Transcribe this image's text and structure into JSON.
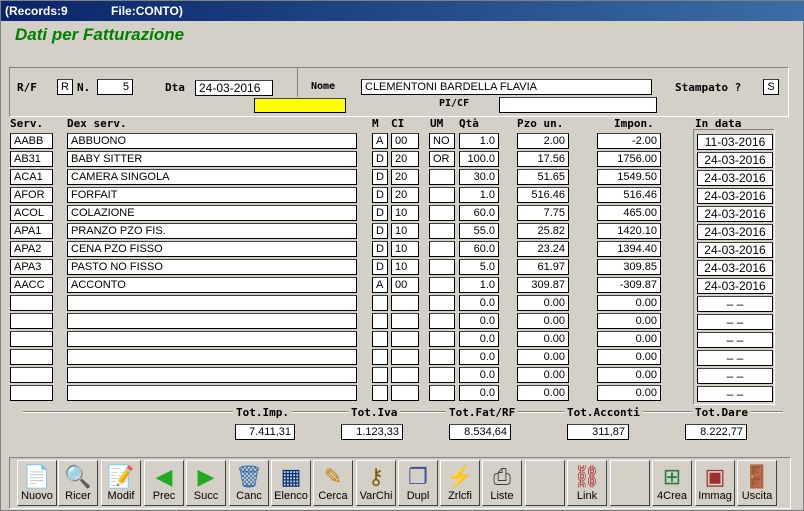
{
  "titlebar": {
    "records": "(Records:9",
    "file": "File:CONTO)"
  },
  "heading": "Dati per Fatturazione",
  "header": {
    "rf_label": "R/F",
    "rf_value": "R",
    "n_label": "N.",
    "n_value": "5",
    "dta_label": "Dta",
    "dta_value": "24-03-2016",
    "nome_label": "Nome",
    "nome_value": "CLEMENTONI BARDELLA FLAVIA",
    "stampato_label": "Stampato ?",
    "stampato_value": "S",
    "picf_label": "PI/CF",
    "picf_value": ""
  },
  "columns": {
    "serv": "Serv.",
    "dex": "Dex serv.",
    "m": "M",
    "ci": "CI",
    "um": "UM",
    "qta": "Qtà",
    "pzo": "Pzo un.",
    "impon": "Impon.",
    "indata": "In data"
  },
  "rows": [
    {
      "serv": "AABB",
      "dex": "ABBUONO",
      "m": "A",
      "ci": "00",
      "um": "NO",
      "qta": "1.0",
      "pzo": "2.00",
      "impon": "-2.00",
      "indata": "11-03-2016"
    },
    {
      "serv": "AB31",
      "dex": "BABY SITTER",
      "m": "D",
      "ci": "20",
      "um": "OR",
      "qta": "100.0",
      "pzo": "17.56",
      "impon": "1756.00",
      "indata": "24-03-2016"
    },
    {
      "serv": "ACA1",
      "dex": "CAMERA SINGOLA",
      "m": "D",
      "ci": "20",
      "um": "",
      "qta": "30.0",
      "pzo": "51.65",
      "impon": "1549.50",
      "indata": "24-03-2016"
    },
    {
      "serv": "AFOR",
      "dex": "FORFAIT",
      "m": "D",
      "ci": "20",
      "um": "",
      "qta": "1.0",
      "pzo": "516.46",
      "impon": "516.46",
      "indata": "24-03-2016"
    },
    {
      "serv": "ACOL",
      "dex": "COLAZIONE",
      "m": "D",
      "ci": "10",
      "um": "",
      "qta": "60.0",
      "pzo": "7.75",
      "impon": "465.00",
      "indata": "24-03-2016"
    },
    {
      "serv": "APA1",
      "dex": "PRANZO PZO FIS.",
      "m": "D",
      "ci": "10",
      "um": "",
      "qta": "55.0",
      "pzo": "25.82",
      "impon": "1420.10",
      "indata": "24-03-2016"
    },
    {
      "serv": "APA2",
      "dex": "CENA PZO FISSO",
      "m": "D",
      "ci": "10",
      "um": "",
      "qta": "60.0",
      "pzo": "23.24",
      "impon": "1394.40",
      "indata": "24-03-2016"
    },
    {
      "serv": "APA3",
      "dex": "PASTO NO FISSO",
      "m": "D",
      "ci": "10",
      "um": "",
      "qta": "5.0",
      "pzo": "61.97",
      "impon": "309.85",
      "indata": "24-03-2016"
    },
    {
      "serv": "AACC",
      "dex": "ACCONTO",
      "m": "A",
      "ci": "00",
      "um": "",
      "qta": "1.0",
      "pzo": "309.87",
      "impon": "-309.87",
      "indata": "24-03-2016"
    },
    {
      "serv": "",
      "dex": "",
      "m": "",
      "ci": "",
      "um": "",
      "qta": "0.0",
      "pzo": "0.00",
      "impon": "0.00",
      "indata": "–  –"
    },
    {
      "serv": "",
      "dex": "",
      "m": "",
      "ci": "",
      "um": "",
      "qta": "0.0",
      "pzo": "0.00",
      "impon": "0.00",
      "indata": "–  –"
    },
    {
      "serv": "",
      "dex": "",
      "m": "",
      "ci": "",
      "um": "",
      "qta": "0.0",
      "pzo": "0.00",
      "impon": "0.00",
      "indata": "–  –"
    },
    {
      "serv": "",
      "dex": "",
      "m": "",
      "ci": "",
      "um": "",
      "qta": "0.0",
      "pzo": "0.00",
      "impon": "0.00",
      "indata": "–  –"
    },
    {
      "serv": "",
      "dex": "",
      "m": "",
      "ci": "",
      "um": "",
      "qta": "0.0",
      "pzo": "0.00",
      "impon": "0.00",
      "indata": "–  –"
    },
    {
      "serv": "",
      "dex": "",
      "m": "",
      "ci": "",
      "um": "",
      "qta": "0.0",
      "pzo": "0.00",
      "impon": "0.00",
      "indata": "–  –"
    }
  ],
  "totals": {
    "imp_label": "Tot.Imp.",
    "imp": "7.411,31",
    "iva_label": "Tot.Iva",
    "iva": "1.123,33",
    "fat_label": "Tot.Fat/RF",
    "fat": "8.534,64",
    "acconti_label": "Tot.Acconti",
    "acconti": "311,87",
    "dare_label": "Tot.Dare",
    "dare": "8.222,77"
  },
  "toolbar": [
    {
      "label": "Nuovo",
      "icon": "new-document-icon",
      "glyph": "📄",
      "color": "#2a8a2a"
    },
    {
      "label": "Ricer",
      "icon": "search-icon",
      "glyph": "🔍",
      "color": "#3050a0"
    },
    {
      "label": "Modif",
      "icon": "edit-icon",
      "glyph": "📝",
      "color": "#3050a0"
    },
    {
      "label": "Prec",
      "icon": "arrow-left-icon",
      "glyph": "◀",
      "color": "#22aa22"
    },
    {
      "label": "Succ",
      "icon": "arrow-right-icon",
      "glyph": "▶",
      "color": "#22aa22"
    },
    {
      "label": "Canc",
      "icon": "trash-icon",
      "glyph": "🗑",
      "color": "#3070b0"
    },
    {
      "label": "Elenco",
      "icon": "list-icon",
      "glyph": "▦",
      "color": "#003080"
    },
    {
      "label": "Cerca",
      "icon": "find-icon",
      "glyph": "✎",
      "color": "#c08000"
    },
    {
      "label": "VarChi",
      "icon": "keys-icon",
      "glyph": "⚷",
      "color": "#806000"
    },
    {
      "label": "Dupl",
      "icon": "duplicate-icon",
      "glyph": "❐",
      "color": "#4050a0"
    },
    {
      "label": "Zrlcfi",
      "icon": "zigzag-icon",
      "glyph": "⚡",
      "color": "#000"
    },
    {
      "label": "Liste",
      "icon": "printer-icon",
      "glyph": "⎙",
      "color": "#404040"
    },
    {
      "label": "Link",
      "icon": "link-icon",
      "glyph": "⛓",
      "color": "#aa2020"
    },
    {
      "label": "4Crea",
      "icon": "create-icon",
      "glyph": "⊞",
      "color": "#208040"
    },
    {
      "label": "Immag",
      "icon": "image-card-icon",
      "glyph": "▣",
      "color": "#a03030"
    },
    {
      "label": "Uscita",
      "icon": "exit-door-icon",
      "glyph": "🚪",
      "color": "#c02020"
    }
  ]
}
